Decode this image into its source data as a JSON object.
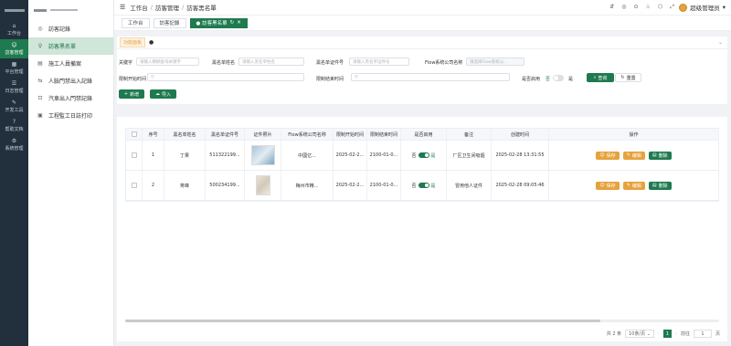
{
  "rail": [
    {
      "icon": "⌂",
      "label": "工作台"
    },
    {
      "icon": "☺",
      "label": "訪客管理"
    },
    {
      "icon": "▦",
      "label": "平台管理"
    },
    {
      "icon": "☰",
      "label": "日志管理"
    },
    {
      "icon": "✎",
      "label": "开发工具"
    },
    {
      "icon": "?",
      "label": "帮助文档"
    },
    {
      "icon": "⚙",
      "label": "系統管理"
    }
  ],
  "sidebar": [
    {
      "icon": "◎",
      "label": "訪客記錄"
    },
    {
      "icon": "♀",
      "label": "訪客黑名單"
    },
    {
      "icon": "▤",
      "label": "施工人員備案"
    },
    {
      "icon": "⇆",
      "label": "人臉門禁出入記錄"
    },
    {
      "icon": "⊡",
      "label": "汽車出入門禁記錄"
    },
    {
      "icon": "▣",
      "label": "工程監工日誌打印"
    }
  ],
  "breadcrumb": [
    "工作台",
    "訪客管理",
    "訪客黑名單"
  ],
  "header": {
    "icons": [
      "⇵",
      "◎",
      "⊙",
      "♧",
      "⬡",
      "⤢"
    ],
    "user": "超级管理员"
  },
  "tabs": [
    {
      "label": "工作台"
    },
    {
      "label": "訪客記錄"
    },
    {
      "label": "● 訪客黑名單"
    }
  ],
  "filter": {
    "badge": "功能面板",
    "keyword": {
      "label": "关键字",
      "placeholder": "请输入模糊查询关键字"
    },
    "name": {
      "label": "黑名单姓名",
      "placeholder": "请输入黑名单姓名"
    },
    "idno": {
      "label": "黑名单证件号",
      "placeholder": "请输入黑名单证件号"
    },
    "company": {
      "label": "Flow系统公司名称",
      "placeholder": "请选择Flow系统公..."
    },
    "start": {
      "label": "限制开始时间",
      "placeholder": ""
    },
    "end": {
      "label": "限制结束时间",
      "placeholder": ""
    },
    "enabled": {
      "label": "是否启用",
      "off": "否",
      "on": "是"
    },
    "search": "查询",
    "reset": "重置",
    "add": "新增",
    "import": "导入"
  },
  "table": {
    "headers": [
      "序号",
      "黑名单姓名",
      "黑名单证件号",
      "证件照片",
      "Flow系统公司名称",
      "限制开始时间",
      "限制结束时间",
      "是否启用",
      "备注",
      "创建时间",
      "操作"
    ],
    "rows": [
      {
        "no": "1",
        "name": "丁果",
        "idno": "511322199...",
        "company": "中國亿...",
        "start": "2025-02-2...",
        "end": "2100-01-0...",
        "off": "否",
        "on": "是",
        "remark": "厂区卫生间吸烟",
        "created": "2025-02-28 13:31:55"
      },
      {
        "no": "2",
        "name": "蒋峰",
        "idno": "500234199...",
        "company": "梅州市精...",
        "start": "2025-02-2...",
        "end": "2100-01-0...",
        "off": "否",
        "on": "是",
        "remark": "冒用他人证件",
        "created": "2025-02-28 09:05:46"
      }
    ],
    "actions": {
      "save": "保存",
      "edit": "编辑",
      "delete": "删除"
    }
  },
  "pager": {
    "total": "共 2 条",
    "size": "10条/页",
    "page": "1",
    "goto": "前往",
    "goto_value": "1",
    "unit": "页"
  }
}
